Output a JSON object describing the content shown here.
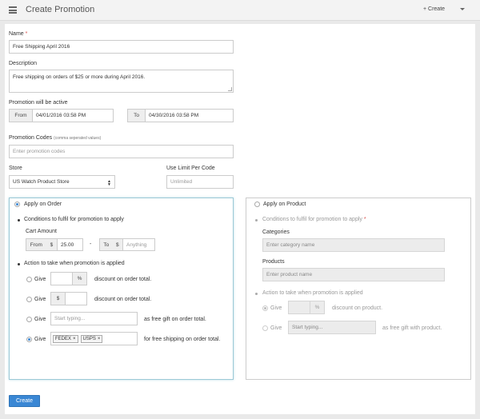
{
  "header": {
    "title": "Create Promotion",
    "create_label": "+ Create"
  },
  "form": {
    "name": {
      "label": "Name",
      "required": "*",
      "value": "Free Shipping April 2016"
    },
    "description": {
      "label": "Description",
      "value": "Free shipping on orders of $25 or more during April 2016."
    },
    "active": {
      "label": "Promotion will be active",
      "from_label": "From",
      "from_value": "04/01/2016 03:58 PM",
      "to_label": "To",
      "to_value": "04/30/2016 03:58 PM"
    },
    "codes": {
      "label": "Promotion Codes",
      "hint": "(comma seperated values)",
      "placeholder": "Enter promotion codes"
    },
    "store": {
      "label": "Store",
      "value": "US Watch Product Store"
    },
    "use_limit": {
      "label": "Use Limit Per Code",
      "placeholder": "Unlimited"
    }
  },
  "order_panel": {
    "title": "Apply on Order",
    "conditions_label": "Conditions to fulfil for promotion to apply",
    "cart_amount_label": "Cart Amount",
    "from_label": "From",
    "from_currency": "$",
    "from_value": "25.00",
    "dash": "-",
    "to_label": "To",
    "to_currency": "$",
    "to_placeholder": "Anything",
    "actions_label": "Action to take when promotion is applied",
    "give_label": "Give",
    "percent_symbol": "%",
    "dollar_symbol": "$",
    "discount_percent_text": "discount on order total.",
    "discount_amount_text": "discount on order total.",
    "free_gift_placeholder": "Start typing...",
    "free_gift_text": "as free gift on order total.",
    "shipping_tags": [
      "FEDEX",
      "USPS"
    ],
    "tag_remove": "×",
    "free_shipping_text": "for free shipping on order total."
  },
  "product_panel": {
    "title": "Apply on Product",
    "conditions_label": "Conditions to fulfil for promotion to apply",
    "required": "*",
    "categories_label": "Categories",
    "categories_placeholder": "Enter category name",
    "products_label": "Products",
    "products_placeholder": "Enter product name",
    "actions_label": "Action to take when promotion is applied",
    "give_label": "Give",
    "percent_symbol": "%",
    "discount_text": "discount on product.",
    "free_gift_placeholder": "Start typing...",
    "free_gift_text": "as free gift with product."
  },
  "submit_label": "Create"
}
